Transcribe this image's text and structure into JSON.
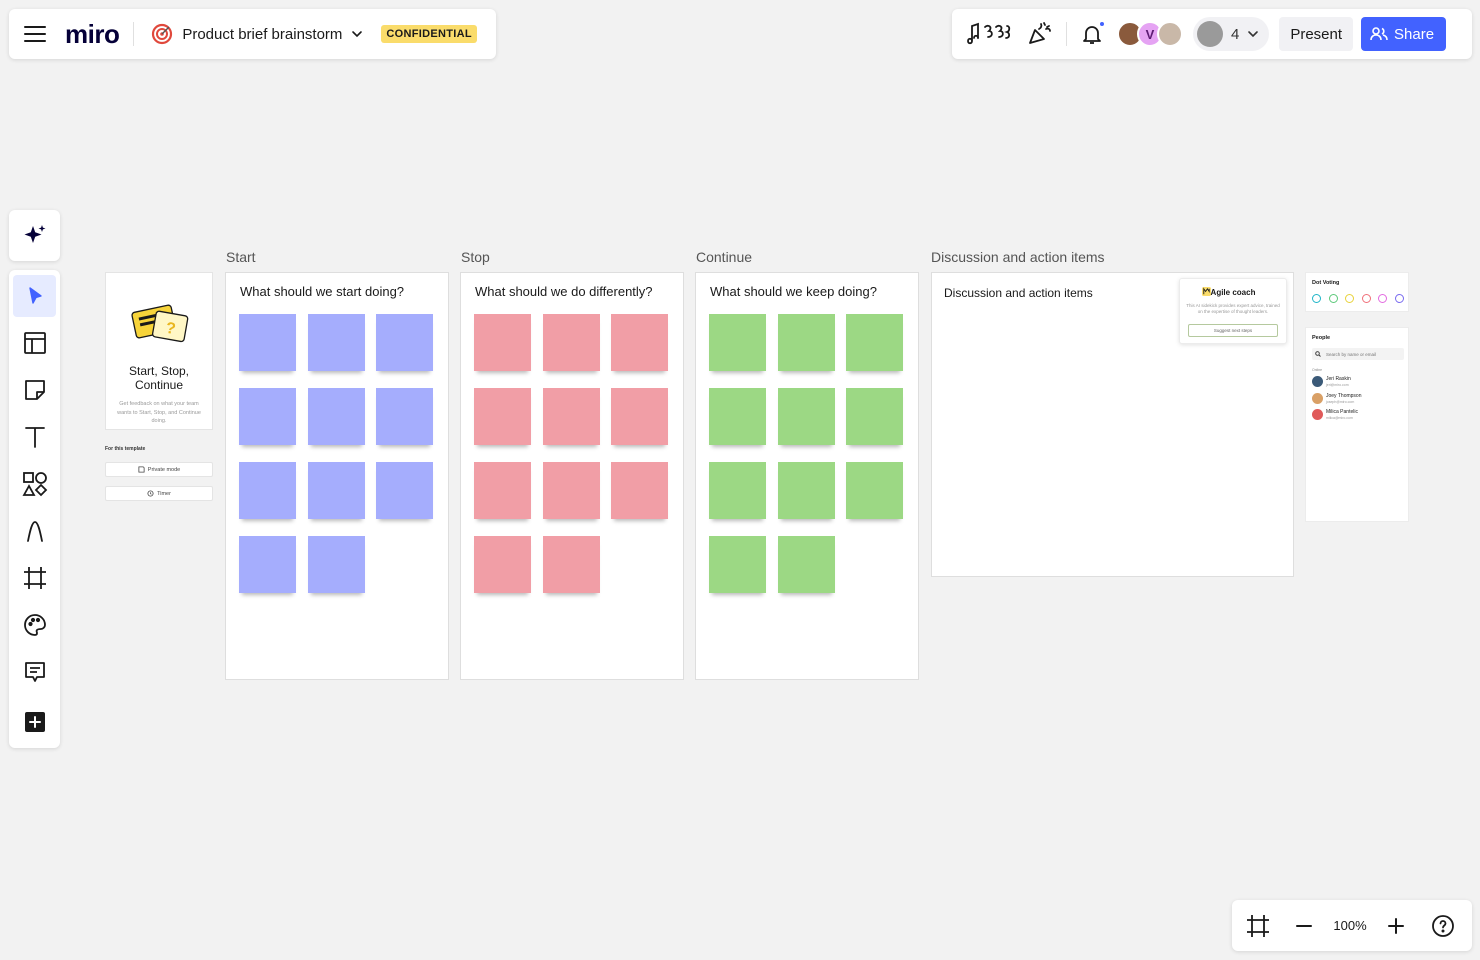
{
  "header": {
    "logo": "miro",
    "board_title": "Product brief brainstorm",
    "badge": "CONFIDENTIAL"
  },
  "topbar": {
    "avatar_initial": "V",
    "collaborator_count": "4",
    "present_label": "Present",
    "share_label": "Share"
  },
  "zoom": {
    "level": "100%"
  },
  "template": {
    "title": "Start, Stop, Continue",
    "description": "Get feedback on what your team wants to Start, Stop, and Continue doing.",
    "for_template_label": "For this template",
    "private_mode_label": "Private mode",
    "timer_label": "Timer"
  },
  "frames": [
    {
      "label": "Start",
      "question": "What should we start doing?",
      "color": "#a5adfd",
      "sticky_count": 11
    },
    {
      "label": "Stop",
      "question": "What should we do differently?",
      "color": "#f19ea6",
      "sticky_count": 11
    },
    {
      "label": "Continue",
      "question": "What should we keep doing?",
      "color": "#9cd884",
      "sticky_count": 11
    }
  ],
  "discussion": {
    "label": "Discussion and action items",
    "text": "Discussion and action items"
  },
  "agile_coach": {
    "title": "Agile coach",
    "description": "This AI sidekick provides expert advice, trained on the expertise of thought leaders.",
    "button_label": "Suggest next steps"
  },
  "dot_voting": {
    "title": "Dot Voting",
    "colors": [
      "#1fb5c8",
      "#5cc97a",
      "#e8d23a",
      "#f0707a",
      "#e36be0",
      "#7a6cf0"
    ]
  },
  "people": {
    "title": "People",
    "search_placeholder": "Search by name or email",
    "online_label": "Online",
    "list": [
      {
        "name": "Jeri Raskin",
        "email": "jeri@miro.com",
        "avatar_color": "#3b5a78"
      },
      {
        "name": "Joey Thompson",
        "email": "joseph@miro.com",
        "avatar_color": "#d9a066"
      },
      {
        "name": "Milica Pantelic",
        "email": "milica@miro.com",
        "avatar_color": "#e05a5a"
      }
    ]
  }
}
